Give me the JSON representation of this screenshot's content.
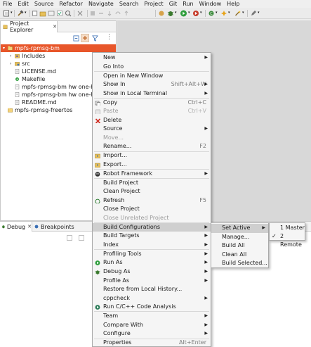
{
  "menubar": [
    "File",
    "Edit",
    "Source",
    "Refactor",
    "Navigate",
    "Search",
    "Project",
    "Git",
    "Run",
    "Window",
    "Help"
  ],
  "explorer": {
    "tab_label": "Project Explorer",
    "tree": [
      {
        "label": "mpfs-rpmsg-bm",
        "twisty": "▾",
        "icon": "project-icon",
        "selected": true
      },
      {
        "label": "Includes",
        "twisty": "›",
        "icon": "includes-icon"
      },
      {
        "label": "src",
        "twisty": "›",
        "icon": "folder-icon"
      },
      {
        "label": "LICENSE.md",
        "icon": "file-icon"
      },
      {
        "label": "Makefile",
        "icon": "makefile-icon"
      },
      {
        "label": "mpfs-rpmsg-bm hw one-hart at",
        "icon": "launch-icon"
      },
      {
        "label": "mpfs-rpmsg-bm hw one-hart at",
        "icon": "launch-icon"
      },
      {
        "label": "README.md",
        "icon": "file-icon"
      },
      {
        "label": "mpfs-rpmsg-freertos",
        "icon": "project-icon"
      }
    ]
  },
  "debug": {
    "tab_label": "Debug",
    "breakpoints_label": "Breakpoints"
  },
  "context_menu": {
    "items": [
      {
        "label": "New",
        "submenu": true
      },
      {
        "label": "Go Into"
      },
      {
        "sep": true
      },
      {
        "label": "Open in New Window"
      },
      {
        "label": "Show In",
        "accel": "Shift+Alt+W",
        "submenu": true
      },
      {
        "label": "Show in Local Terminal",
        "submenu": true
      },
      {
        "sep": true
      },
      {
        "label": "Copy",
        "accel": "Ctrl+C",
        "icon": "copy-icon"
      },
      {
        "label": "Paste",
        "accel": "Ctrl+V",
        "icon": "paste-icon",
        "disabled": true
      },
      {
        "label": "Delete",
        "icon": "delete-icon"
      },
      {
        "label": "Source",
        "submenu": true
      },
      {
        "label": "Move...",
        "disabled": true
      },
      {
        "label": "Rename...",
        "accel": "F2"
      },
      {
        "sep": true
      },
      {
        "label": "Import...",
        "icon": "import-icon"
      },
      {
        "label": "Export...",
        "icon": "export-icon"
      },
      {
        "sep": true
      },
      {
        "label": "Robot Framework",
        "icon": "robot-icon",
        "submenu": true
      },
      {
        "sep": true
      },
      {
        "label": "Build Project"
      },
      {
        "label": "Clean Project"
      },
      {
        "label": "Refresh",
        "accel": "F5",
        "icon": "refresh-icon"
      },
      {
        "label": "Close Project"
      },
      {
        "label": "Close Unrelated Project",
        "disabled": true
      },
      {
        "sep": true
      },
      {
        "label": "Build Configurations",
        "submenu": true,
        "highlighted": true
      },
      {
        "label": "Build Targets",
        "submenu": true
      },
      {
        "label": "Index",
        "submenu": true
      },
      {
        "sep": true
      },
      {
        "label": "Profiling Tools",
        "submenu": true
      },
      {
        "label": "Run As",
        "icon": "run-icon",
        "submenu": true
      },
      {
        "label": "Debug As",
        "icon": "debug-icon",
        "submenu": true
      },
      {
        "label": "Profile As",
        "submenu": true
      },
      {
        "label": "Restore from Local History..."
      },
      {
        "label": "cppcheck",
        "submenu": true
      },
      {
        "label": "Run C/C++ Code Analysis",
        "icon": "analysis-icon"
      },
      {
        "sep": true
      },
      {
        "label": "Team",
        "submenu": true
      },
      {
        "label": "Compare With",
        "submenu": true
      },
      {
        "label": "Configure",
        "submenu": true
      },
      {
        "sep": true
      },
      {
        "label": "Properties",
        "accel": "Alt+Enter"
      }
    ]
  },
  "build_config_menu": {
    "items": [
      {
        "label": "Set Active",
        "submenu": true,
        "highlighted": true
      },
      {
        "label": "Manage..."
      },
      {
        "label": "Build All"
      },
      {
        "label": "Clean All"
      },
      {
        "label": "Build Selected..."
      }
    ]
  },
  "set_active_menu": {
    "items": [
      {
        "label": "1 Master",
        "checked": false
      },
      {
        "label": "2 Remote",
        "checked": true
      }
    ]
  },
  "colors": {
    "selection": "#e8562a",
    "run": "#2e9e3c",
    "delete": "#d02b20",
    "debug": "#3b7a2f"
  }
}
